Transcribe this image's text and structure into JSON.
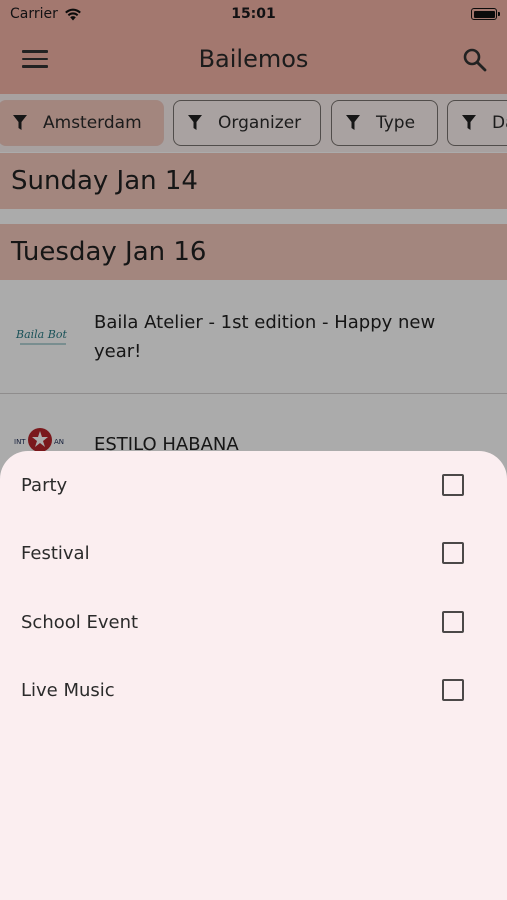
{
  "status_bar": {
    "carrier": "Carrier",
    "time": "15:01"
  },
  "app_bar": {
    "title": "Bailemos",
    "menu_icon": "menu-icon",
    "search_icon": "search-icon"
  },
  "filters": {
    "chips": [
      {
        "label": "Amsterdam",
        "selected": true
      },
      {
        "label": "Organizer",
        "selected": false
      },
      {
        "label": "Type",
        "selected": false
      },
      {
        "label": "Da",
        "selected": false
      }
    ]
  },
  "list": {
    "days": [
      "Sunday Jan 14",
      "Tuesday Jan 16"
    ],
    "events": [
      {
        "title": "Baila Atelier - 1st edition - Happy new year!"
      },
      {
        "title": "ESTILO HABANA"
      }
    ]
  },
  "type_sheet": {
    "options": [
      {
        "label": "Party",
        "checked": false
      },
      {
        "label": "Festival",
        "checked": false
      },
      {
        "label": "School Event",
        "checked": false
      },
      {
        "label": "Live Music",
        "checked": false
      }
    ]
  },
  "colors": {
    "primary": "#f4b4a6",
    "sheet_background": "#fbeef0",
    "chip_selected": "#f4c8bd"
  }
}
